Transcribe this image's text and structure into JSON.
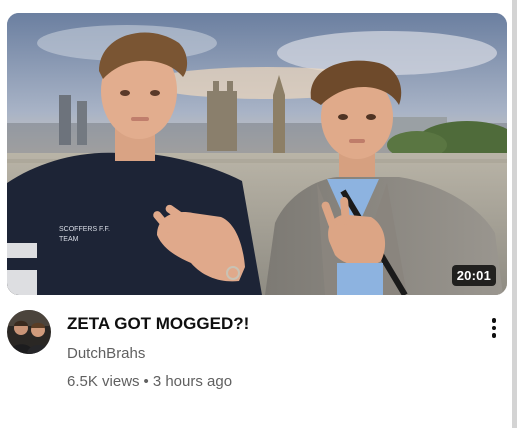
{
  "video": {
    "title": "ZETA GOT MOGGED?!",
    "duration": "20:01",
    "thumbnail_shirt_text_line1": "SCOFFERS F.F.",
    "thumbnail_shirt_text_line2": "TEAM"
  },
  "channel": {
    "name": "DutchBrahs"
  },
  "stats": {
    "views": "6.5K views",
    "separator": "•",
    "age": "3 hours ago"
  },
  "icons": {
    "menu": "more-vert-icon"
  }
}
